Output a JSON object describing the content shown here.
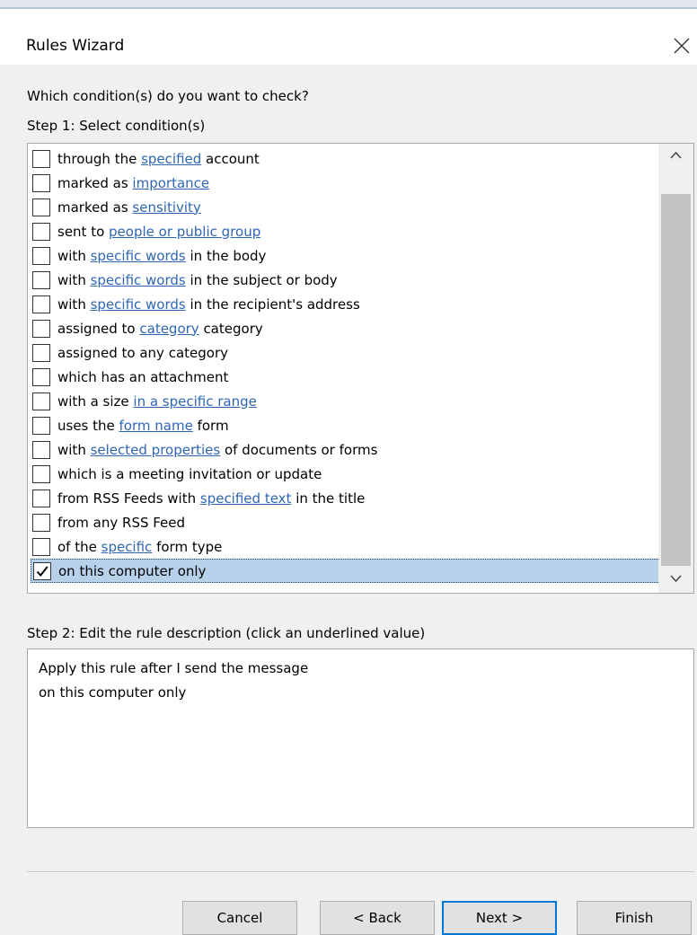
{
  "window": {
    "title": "Rules Wizard"
  },
  "prompt": "Which condition(s) do you want to check?",
  "step1_label": "Step 1: Select condition(s)",
  "conditions": [
    {
      "checked": false,
      "selected": false,
      "parts": [
        {
          "text": "through the "
        },
        {
          "text": "specified",
          "link": true
        },
        {
          "text": " account"
        }
      ]
    },
    {
      "checked": false,
      "selected": false,
      "parts": [
        {
          "text": "marked as "
        },
        {
          "text": "importance",
          "link": true
        }
      ]
    },
    {
      "checked": false,
      "selected": false,
      "parts": [
        {
          "text": "marked as "
        },
        {
          "text": "sensitivity",
          "link": true
        }
      ]
    },
    {
      "checked": false,
      "selected": false,
      "parts": [
        {
          "text": "sent to "
        },
        {
          "text": "people or public group",
          "link": true
        }
      ]
    },
    {
      "checked": false,
      "selected": false,
      "parts": [
        {
          "text": "with "
        },
        {
          "text": "specific words",
          "link": true
        },
        {
          "text": " in the body"
        }
      ]
    },
    {
      "checked": false,
      "selected": false,
      "parts": [
        {
          "text": "with "
        },
        {
          "text": "specific words",
          "link": true
        },
        {
          "text": " in the subject or body"
        }
      ]
    },
    {
      "checked": false,
      "selected": false,
      "parts": [
        {
          "text": "with "
        },
        {
          "text": "specific words",
          "link": true
        },
        {
          "text": " in the recipient's address"
        }
      ]
    },
    {
      "checked": false,
      "selected": false,
      "parts": [
        {
          "text": "assigned to "
        },
        {
          "text": "category",
          "link": true
        },
        {
          "text": " category"
        }
      ]
    },
    {
      "checked": false,
      "selected": false,
      "parts": [
        {
          "text": "assigned to any category"
        }
      ]
    },
    {
      "checked": false,
      "selected": false,
      "parts": [
        {
          "text": "which has an attachment"
        }
      ]
    },
    {
      "checked": false,
      "selected": false,
      "parts": [
        {
          "text": "with a size "
        },
        {
          "text": "in a specific range",
          "link": true
        }
      ]
    },
    {
      "checked": false,
      "selected": false,
      "parts": [
        {
          "text": "uses the "
        },
        {
          "text": "form name",
          "link": true
        },
        {
          "text": " form"
        }
      ]
    },
    {
      "checked": false,
      "selected": false,
      "parts": [
        {
          "text": "with "
        },
        {
          "text": "selected properties",
          "link": true
        },
        {
          "text": " of documents or forms"
        }
      ]
    },
    {
      "checked": false,
      "selected": false,
      "parts": [
        {
          "text": "which is a meeting invitation or update"
        }
      ]
    },
    {
      "checked": false,
      "selected": false,
      "parts": [
        {
          "text": "from RSS Feeds with "
        },
        {
          "text": "specified text",
          "link": true
        },
        {
          "text": " in the title"
        }
      ]
    },
    {
      "checked": false,
      "selected": false,
      "parts": [
        {
          "text": "from any RSS Feed"
        }
      ]
    },
    {
      "checked": false,
      "selected": false,
      "parts": [
        {
          "text": "of the "
        },
        {
          "text": "specific",
          "link": true
        },
        {
          "text": " form type"
        }
      ]
    },
    {
      "checked": true,
      "selected": true,
      "parts": [
        {
          "text": "on this computer only"
        }
      ]
    }
  ],
  "step2_label": "Step 2: Edit the rule description (click an underlined value)",
  "description": [
    "Apply this rule after I send the message",
    "on this computer only"
  ],
  "buttons": {
    "cancel": "Cancel",
    "back": "< Back",
    "next": "Next >",
    "finish": "Finish"
  },
  "colors": {
    "link": "#2f66b3",
    "selection": "#b7d1ea",
    "default_button_border": "#0078d7"
  },
  "icons": {
    "close": "close-icon",
    "checkmark": "checkmark-icon",
    "scroll_up": "chevron-up-icon",
    "scroll_down": "chevron-down-icon"
  }
}
